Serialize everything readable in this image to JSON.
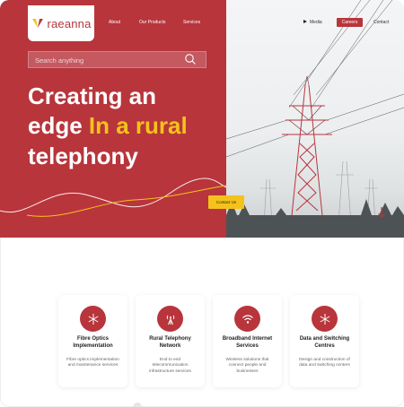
{
  "brand": {
    "name": "raeanna",
    "color": "#b8353c"
  },
  "nav": {
    "left": [
      "About",
      "Our Products",
      "Services"
    ],
    "media": "Media",
    "careers": "Careers",
    "contact": "Contact"
  },
  "search": {
    "placeholder": "Search anything"
  },
  "hero": {
    "line1": "Creating an",
    "line2_white": "edge",
    "line2_yellow": "In a rural",
    "line3": "telephony",
    "cta": "Contact Us"
  },
  "services": [
    {
      "title": "Fibre Optics Implementation",
      "desc": "Fibre optics implementation and maintenance services",
      "icon": "snowflake-icon"
    },
    {
      "title": "Rural Telephony Network",
      "desc": "End to end telecommunication infrastructure services",
      "icon": "antenna-icon"
    },
    {
      "title": "Broadband Internet Services",
      "desc": "Wireless solutions that connect people and businesses",
      "icon": "wifi-icon"
    },
    {
      "title": "Data and Switching Centres",
      "desc": "Design and construction of data and switching centers",
      "icon": "snowflake-icon"
    }
  ],
  "colors": {
    "accent": "#b8353c",
    "yellow": "#f5c21b"
  }
}
